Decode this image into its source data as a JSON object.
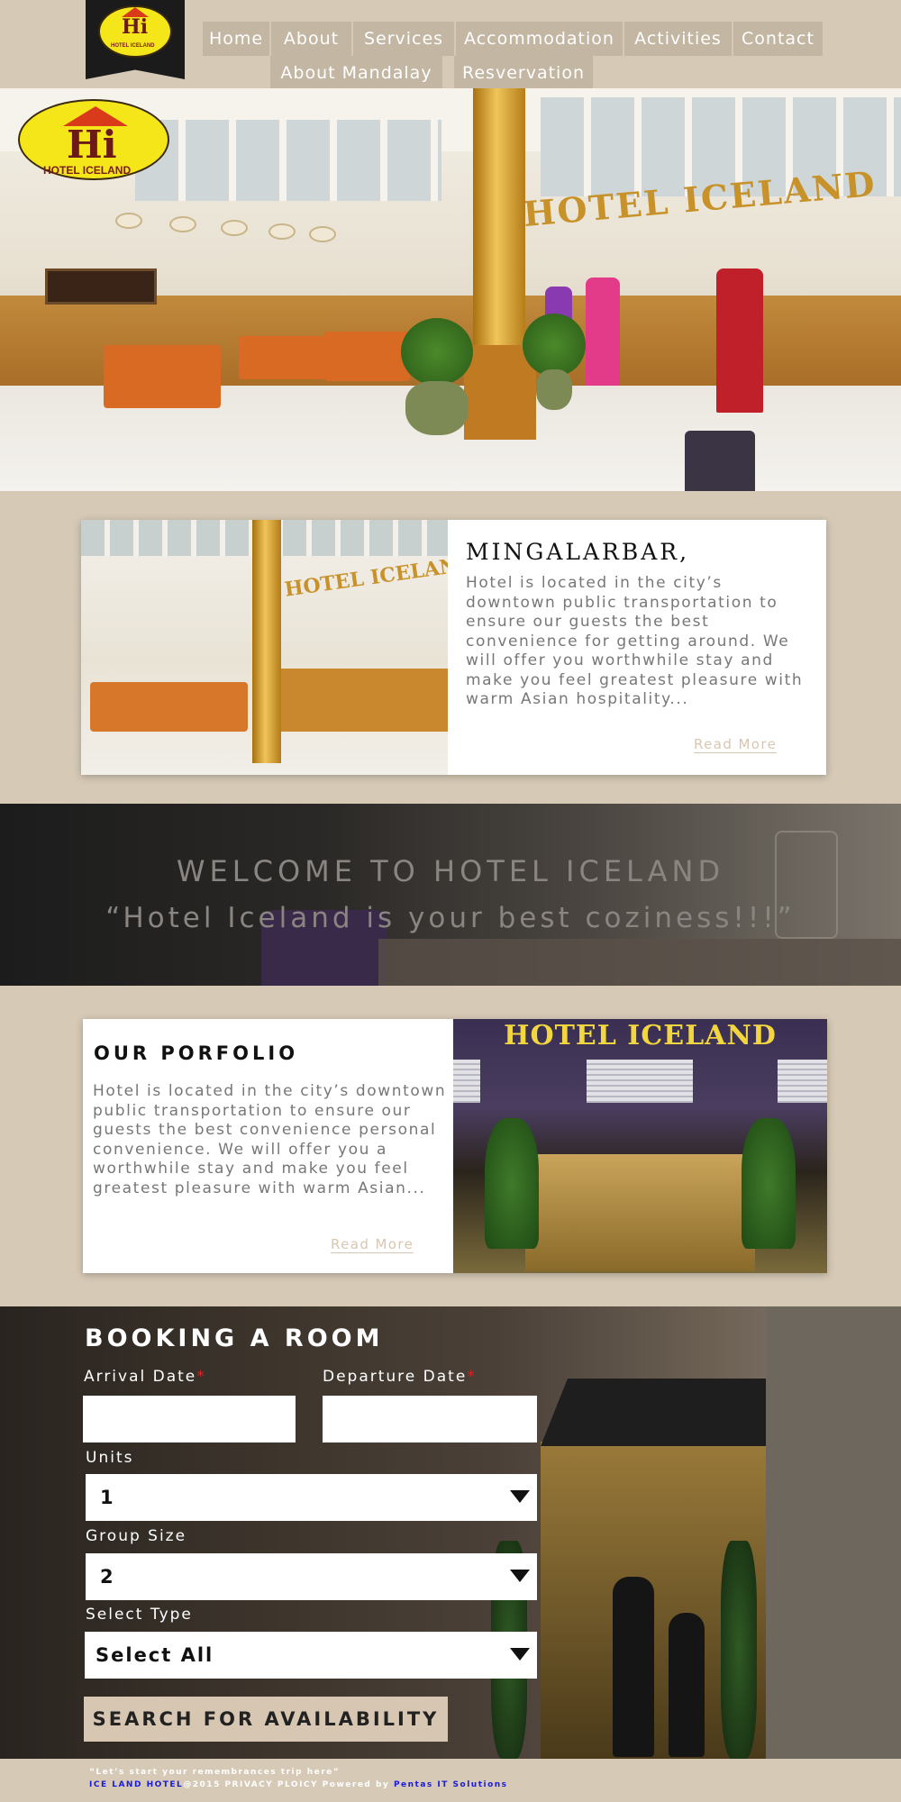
{
  "brand": {
    "logo_line": "HOTEL ICELAND",
    "logo_mark": "Hi",
    "colors": {
      "background": "#d6c9b6",
      "nav": "#c3b6a3",
      "logo_yellow": "#f5e61a",
      "logo_red": "#6b1a18",
      "link_blue": "#1a1ae0"
    }
  },
  "nav": {
    "row1": [
      "Home",
      "About",
      "Services",
      "Accommodation",
      "Activities",
      "Contact"
    ],
    "row2": [
      "About Mandalay",
      "Resvervation"
    ]
  },
  "hero": {
    "sign_text": "HOTEL ICELAND"
  },
  "intro": {
    "title": "MINGALARBAR,",
    "text": "Hotel  is located in the city’s downtown public transportation to ensure our guests the best convenience for getting around. We will offer you worthwhile stay and make you feel greatest pleasure with warm Asian hospitality...",
    "read_more": "Read More",
    "photo_sign": "HOTEL ICELAND"
  },
  "welcome": {
    "title": "WELCOME TO HOTEL ICELAND",
    "quote": "“Hotel Iceland is your best coziness!!!”"
  },
  "portfolio": {
    "title": "OUR PORFOLIO",
    "text": "Hotel  is located in the city’s downtown public transportation to ensure our guests the best convenience personal convenience. We will offer you a worthwhile stay and make you feel greatest pleasure with warm Asian...",
    "read_more": "Read More",
    "photo_sign": "HOTEL ICELAND"
  },
  "booking": {
    "title": "BOOKING A ROOM",
    "arrival_label": "Arrival Date",
    "departure_label": "Departure Date",
    "required_mark": "*",
    "arrival_value": "",
    "departure_value": "",
    "units_label": "Units",
    "units_value": "1",
    "group_label": "Group Size",
    "group_value": "2",
    "type_label": "Select Type",
    "type_value": "Select All",
    "search_button": "SEARCH FOR AVAILABILITY"
  },
  "footer": {
    "tagline": "“Let’s start your remembrances trip here”",
    "brand_link": "ICE LAND HOTEL",
    "middle": "@2015 PRIVACY PLOICY Powered by ",
    "powered_link": "Pentas IT Solutions"
  }
}
